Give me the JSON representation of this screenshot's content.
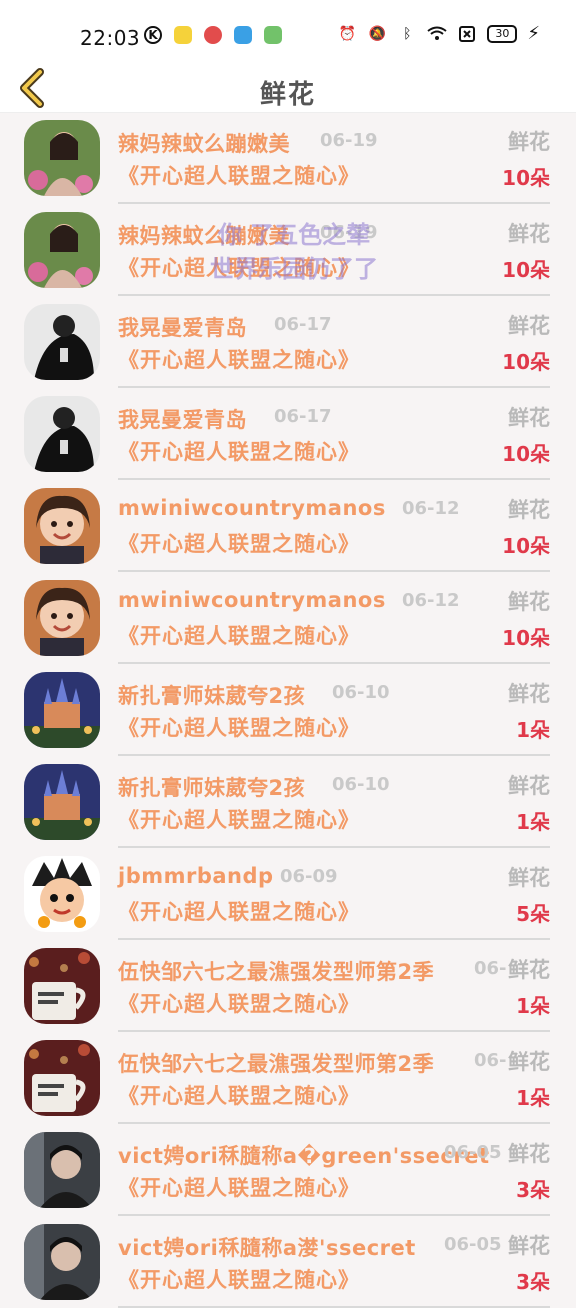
{
  "status_bar": {
    "time": "22:03",
    "battery": "30"
  },
  "header": {
    "title": "鲜花",
    "back_icon": "chevron-left-icon"
  },
  "overlay": {
    "line1": "你 了五色之辇",
    "line2": "世界乐园仍了了"
  },
  "colors": {
    "name": "#f39a66",
    "amount": "#e0394a",
    "muted": "#b9b9b9"
  },
  "rows": [
    {
      "name": "辣妈辣蚊么蹦嫩美",
      "date": "06-19",
      "type": "鲜花",
      "program": "《开心超人联盟之随心》",
      "amount": "10朵",
      "avatar": "woman-flowers"
    },
    {
      "name": "辣妈辣蚊么蹦嫩美",
      "date": "06-19",
      "type": "鲜花",
      "program": "《开心超人联盟之随心》",
      "amount": "10朵",
      "avatar": "woman-flowers"
    },
    {
      "name": "我晃曼爱青岛",
      "date": "06-17",
      "type": "鲜花",
      "program": "《开心超人联盟之随心》",
      "amount": "10朵",
      "avatar": "man-shadow"
    },
    {
      "name": "我晃曼爱青岛",
      "date": "06-17",
      "type": "鲜花",
      "program": "《开心超人联盟之随心》",
      "amount": "10朵",
      "avatar": "man-shadow"
    },
    {
      "name": "mwiniwcountrymanos",
      "date": "06-12",
      "type": "鲜花",
      "program": "《开心超人联盟之随心》",
      "amount": "10朵",
      "avatar": "girl-smile"
    },
    {
      "name": "mwiniwcountrymanos",
      "date": "06-12",
      "type": "鲜花",
      "program": "《开心超人联盟之随心》",
      "amount": "10朵",
      "avatar": "girl-smile"
    },
    {
      "name": "新扎膏师妹葳夸2孩",
      "date": "06-10",
      "type": "鲜花",
      "program": "《开心超人联盟之随心》",
      "amount": "1朵",
      "avatar": "castle-night"
    },
    {
      "name": "新扎膏师妹葳夸2孩",
      "date": "06-10",
      "type": "鲜花",
      "program": "《开心超人联盟之随心》",
      "amount": "1朵",
      "avatar": "castle-night"
    },
    {
      "name": "jbmmrbandp",
      "date": "06-09",
      "type": "鲜花",
      "program": "《开心超人联盟之随心》",
      "amount": "5朵",
      "avatar": "cartoon-boy"
    },
    {
      "name": "伍快邹六七之最潐强发型师第2季",
      "date": "06-",
      "type": "鲜花",
      "program": "《开心超人联盟之随心》",
      "amount": "1朵",
      "avatar": "coffee-cup"
    },
    {
      "name": "伍快邹六七之最潐强发型师第2季",
      "date": "06-",
      "type": "鲜花",
      "program": "《开心超人联盟之随心》",
      "amount": "1朵",
      "avatar": "coffee-cup"
    },
    {
      "name": "vict娉ori秝膸称a�green'ssecret",
      "date": "06-05",
      "type": "鲜花",
      "program": "《开心超人联盟之随心》",
      "amount": "3朵",
      "avatar": "man-dark"
    },
    {
      "name": "vict娉ori秝膸称a漤'ssecret",
      "date": "06-05",
      "type": "鲜花",
      "program": "《开心超人联盟之随心》",
      "amount": "3朵",
      "avatar": "man-dark"
    }
  ]
}
